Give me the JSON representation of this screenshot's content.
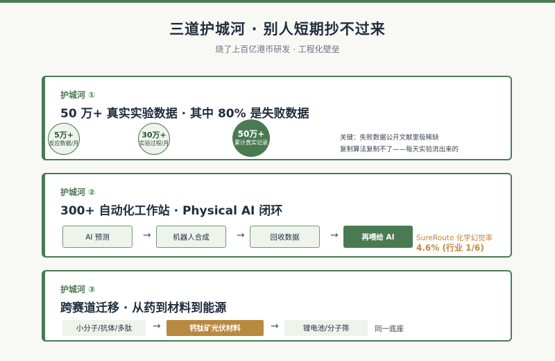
{
  "header": {
    "title": "三道护城河 · 别人短期抄不过来",
    "subtitle": "烧了上百亿港币研发 · 工程化壁垒"
  },
  "moat1": {
    "label": "护城河 ①",
    "heading": "50 万+ 真实实验数据 · 其中 80% 是失败数据",
    "circles": [
      {
        "value": "5万+",
        "label": "反应数据/月"
      },
      {
        "value": "30万+",
        "label": "实验过程/月"
      },
      {
        "value": "50万+",
        "label": "累计真实记录"
      }
    ],
    "notes": [
      "关键：失败数据公开文献里极稀缺",
      "复制算法复制不了——每天实验流出来的"
    ]
  },
  "moat2": {
    "label": "护城河 ②",
    "heading": "300+ 自动化工作站 · Physical AI 闭环",
    "steps": [
      "AI 预测",
      "机器人合成",
      "回收数据",
      "再喂给 AI"
    ],
    "arrow": "→",
    "stat_line1": "SureRoute 化学幻觉率",
    "stat_line2": "4.6% (行业 1/6)"
  },
  "moat3": {
    "label": "护城河 ③",
    "heading": "跨赛道迁移 · 从药到材料到能源",
    "chain": [
      "小分子/抗体/多肽",
      "钙钛矿光伏材料",
      "锂电池/分子筛"
    ],
    "arrow": "→",
    "tail": "同一底座"
  },
  "colors": {
    "accent": "#4a7a52",
    "accent_light": "#eef3ec",
    "gold": "#b8893f",
    "stat_orange": "#c0873f"
  }
}
